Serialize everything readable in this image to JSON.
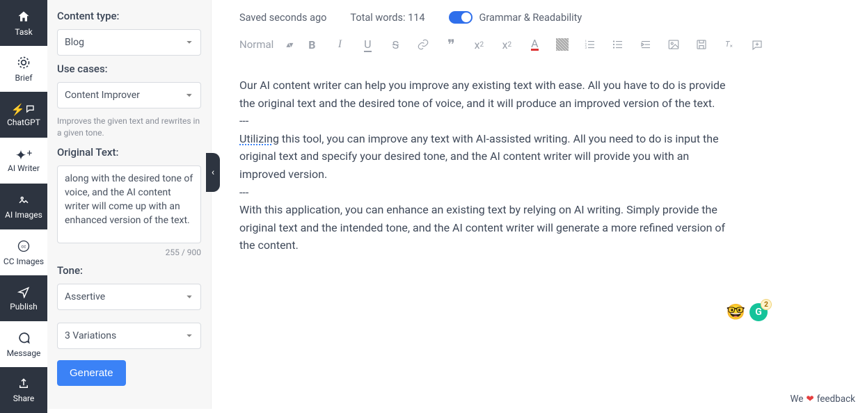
{
  "sidebar": {
    "items": [
      {
        "label": "Task",
        "icon": "home-icon"
      },
      {
        "label": "Brief",
        "icon": "target-icon"
      },
      {
        "label": "ChatGPT",
        "icon": "bolt-chat-icon"
      },
      {
        "label": "AI Writer",
        "icon": "wand-icon"
      },
      {
        "label": "AI Images",
        "icon": "image-icon"
      },
      {
        "label": "CC Images",
        "icon": "cc-icon"
      },
      {
        "label": "Publish",
        "icon": "send-icon"
      },
      {
        "label": "Message",
        "icon": "chat-icon"
      },
      {
        "label": "Share",
        "icon": "share-icon"
      }
    ],
    "active_index": 0
  },
  "config": {
    "content_type_label": "Content type:",
    "content_type_value": "Blog",
    "use_cases_label": "Use cases:",
    "use_cases_value": "Content Improver",
    "use_cases_desc": "Improves the given text and rewrites in a given tone.",
    "original_text_label": "Original Text:",
    "original_text_value": "along with the desired tone of voice, and the AI content writer will come up with an enhanced version of the text.",
    "char_count": "255 / 900",
    "tone_label": "Tone:",
    "tone_value": "Assertive",
    "variations_value": "3 Variations",
    "generate_label": "Generate"
  },
  "collapse_handle_glyph": "‹",
  "editor": {
    "saved_status": "Saved seconds ago",
    "word_count_label": "Total words: 114",
    "grammar_toggle_label": "Grammar & Readability",
    "heading_style": "Normal",
    "body": {
      "p1": "Our AI content writer can help you improve any existing text with ease. All you have to do is provide the original text and the desired tone of voice, and it will produce an improved version of the text.",
      "sep1": "---",
      "p2a": "Utilizing",
      "p2b": " this tool, you can improve any text with AI-assisted writing. All you need to do is input the original text and specify your desired tone, and the AI content writer will provide you with an improved version.",
      "sep2": "---",
      "p3": "With this application, you can enhance an existing text by relying on AI writing. Simply provide the original text and the intended tone, and the AI content writer will generate a more refined version of the content."
    }
  },
  "badges": {
    "emoji": "🤓",
    "g_label": "G",
    "g_count": "2"
  },
  "footer": {
    "we": "We",
    "heart": "❤",
    "feedback": "feedback"
  }
}
